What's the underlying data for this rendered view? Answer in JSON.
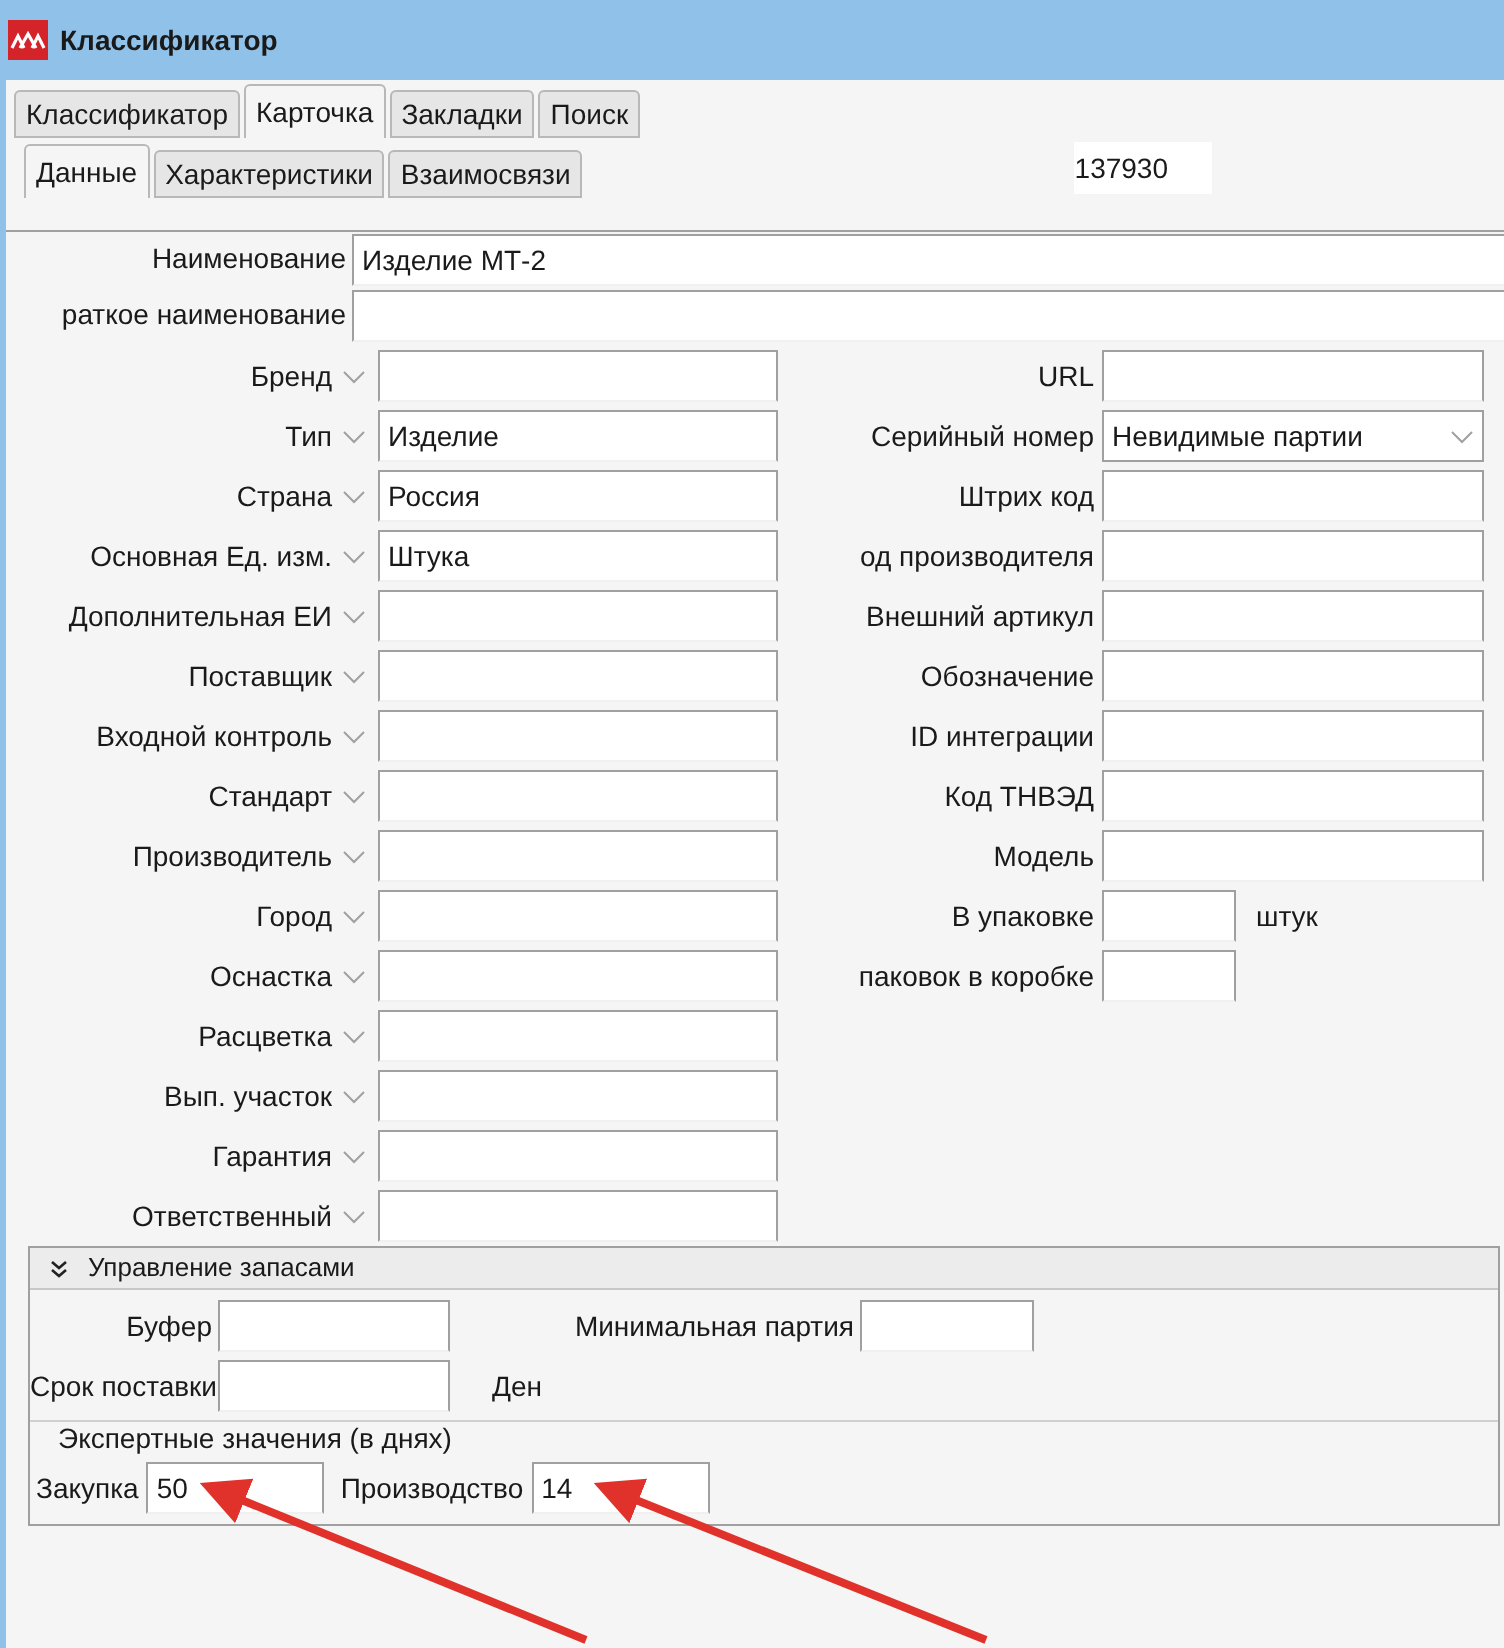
{
  "window": {
    "title": "Классификатор"
  },
  "tabs": [
    {
      "label": "Классификатор",
      "selected": false
    },
    {
      "label": "Карточка",
      "selected": true
    },
    {
      "label": "Закладки",
      "selected": false
    },
    {
      "label": "Поиск",
      "selected": false
    }
  ],
  "subtabs": [
    {
      "label": "Данные",
      "selected": true
    },
    {
      "label": "Характеристики",
      "selected": false
    },
    {
      "label": "Взаимосвязи",
      "selected": false
    }
  ],
  "record_id": "137930",
  "name_fields": [
    {
      "label": "Наименование",
      "value": "Изделие МТ-2"
    },
    {
      "label": "раткое наименование"
    }
  ],
  "left_fields": [
    {
      "label": "Бренд"
    },
    {
      "label": "Тип",
      "value": "Изделие"
    },
    {
      "label": "Страна",
      "value": "Россия"
    },
    {
      "label": "Основная Ед. изм.",
      "value": "Штука"
    },
    {
      "label": "Дополнительная ЕИ"
    },
    {
      "label": "Поставщик"
    },
    {
      "label": "Входной контроль"
    },
    {
      "label": "Стандарт"
    },
    {
      "label": "Производитель"
    },
    {
      "label": "Город"
    },
    {
      "label": "Оснастка"
    },
    {
      "label": "Расцветка"
    },
    {
      "label": "Вып. участок"
    },
    {
      "label": "Гарантия"
    },
    {
      "label": "Ответственный"
    }
  ],
  "right_fields": [
    {
      "kind": "text",
      "label": "URL"
    },
    {
      "kind": "select",
      "label": "Серийный номер",
      "value": "Невидимые партии"
    },
    {
      "kind": "text",
      "label": "Штрих код"
    },
    {
      "kind": "text",
      "label": "од производителя"
    },
    {
      "kind": "text",
      "label": "Внешний артикул"
    },
    {
      "kind": "text",
      "label": "Обозначение"
    },
    {
      "kind": "text",
      "label": "ID интеграции"
    },
    {
      "kind": "text",
      "label": "Код ТНВЭД"
    },
    {
      "kind": "text",
      "label": "Модель"
    },
    {
      "kind": "small",
      "label": "В упаковке",
      "unit": "штук"
    },
    {
      "kind": "small",
      "label": "паковок в коробке"
    }
  ],
  "stock_section": {
    "title": "Управление запасами",
    "expanded": true,
    "buffer": {
      "label": "Буфер"
    },
    "min_batch": {
      "label": "Минимальная партия"
    },
    "lead_time": {
      "label": "Срок поставки",
      "unit": "Ден"
    },
    "expert": {
      "title": "Экспертные значения (в днях)",
      "fields": [
        {
          "label": "Закупка",
          "value": "50"
        },
        {
          "label": "Производство",
          "value": "14"
        }
      ]
    }
  }
}
